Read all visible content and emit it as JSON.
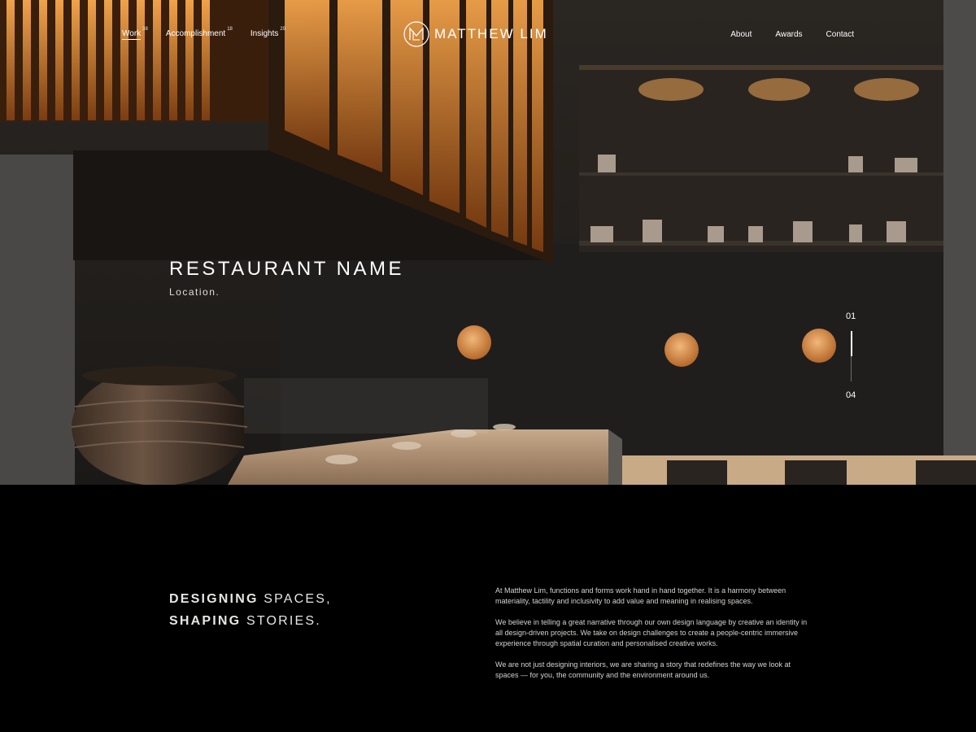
{
  "nav": {
    "left": [
      {
        "label": "Work",
        "count": "38",
        "active": true
      },
      {
        "label": "Accomplishment",
        "count": "18",
        "active": false
      },
      {
        "label": "Insights",
        "count": "29",
        "active": false
      }
    ],
    "brand": "MATTHEW LIM",
    "right": [
      {
        "label": "About"
      },
      {
        "label": "Awards"
      },
      {
        "label": "Contact"
      }
    ]
  },
  "hero": {
    "title": "RESTAURANT NAME",
    "location": "Location.",
    "slide_current": "01",
    "slide_total": "04",
    "slide_progress": 0.25
  },
  "intro": {
    "tagline": {
      "line1_bold": "DESIGNING",
      "line1_rest": " SPACES,",
      "line2_bold": "SHAPING",
      "line2_rest": " STORIES."
    },
    "paragraphs": [
      "At Matthew Lim, functions and forms work hand in hand together. It is a harmony between materiality, tactility and inclusivity to add value and meaning in realising spaces.",
      "We believe in telling a great narrative through our own design language by creative an identity in all design-driven projects. We take on design challenges to create a people-centric immersive experience through spatial curation and personalised creative works.",
      "We are not just designing interiors, we are sharing a story that redefines the way we look at spaces — for you, the community and the environment around us."
    ]
  },
  "colors": {
    "accent_warm": "#d4883a",
    "background": "#000000",
    "text": "#ffffff"
  }
}
